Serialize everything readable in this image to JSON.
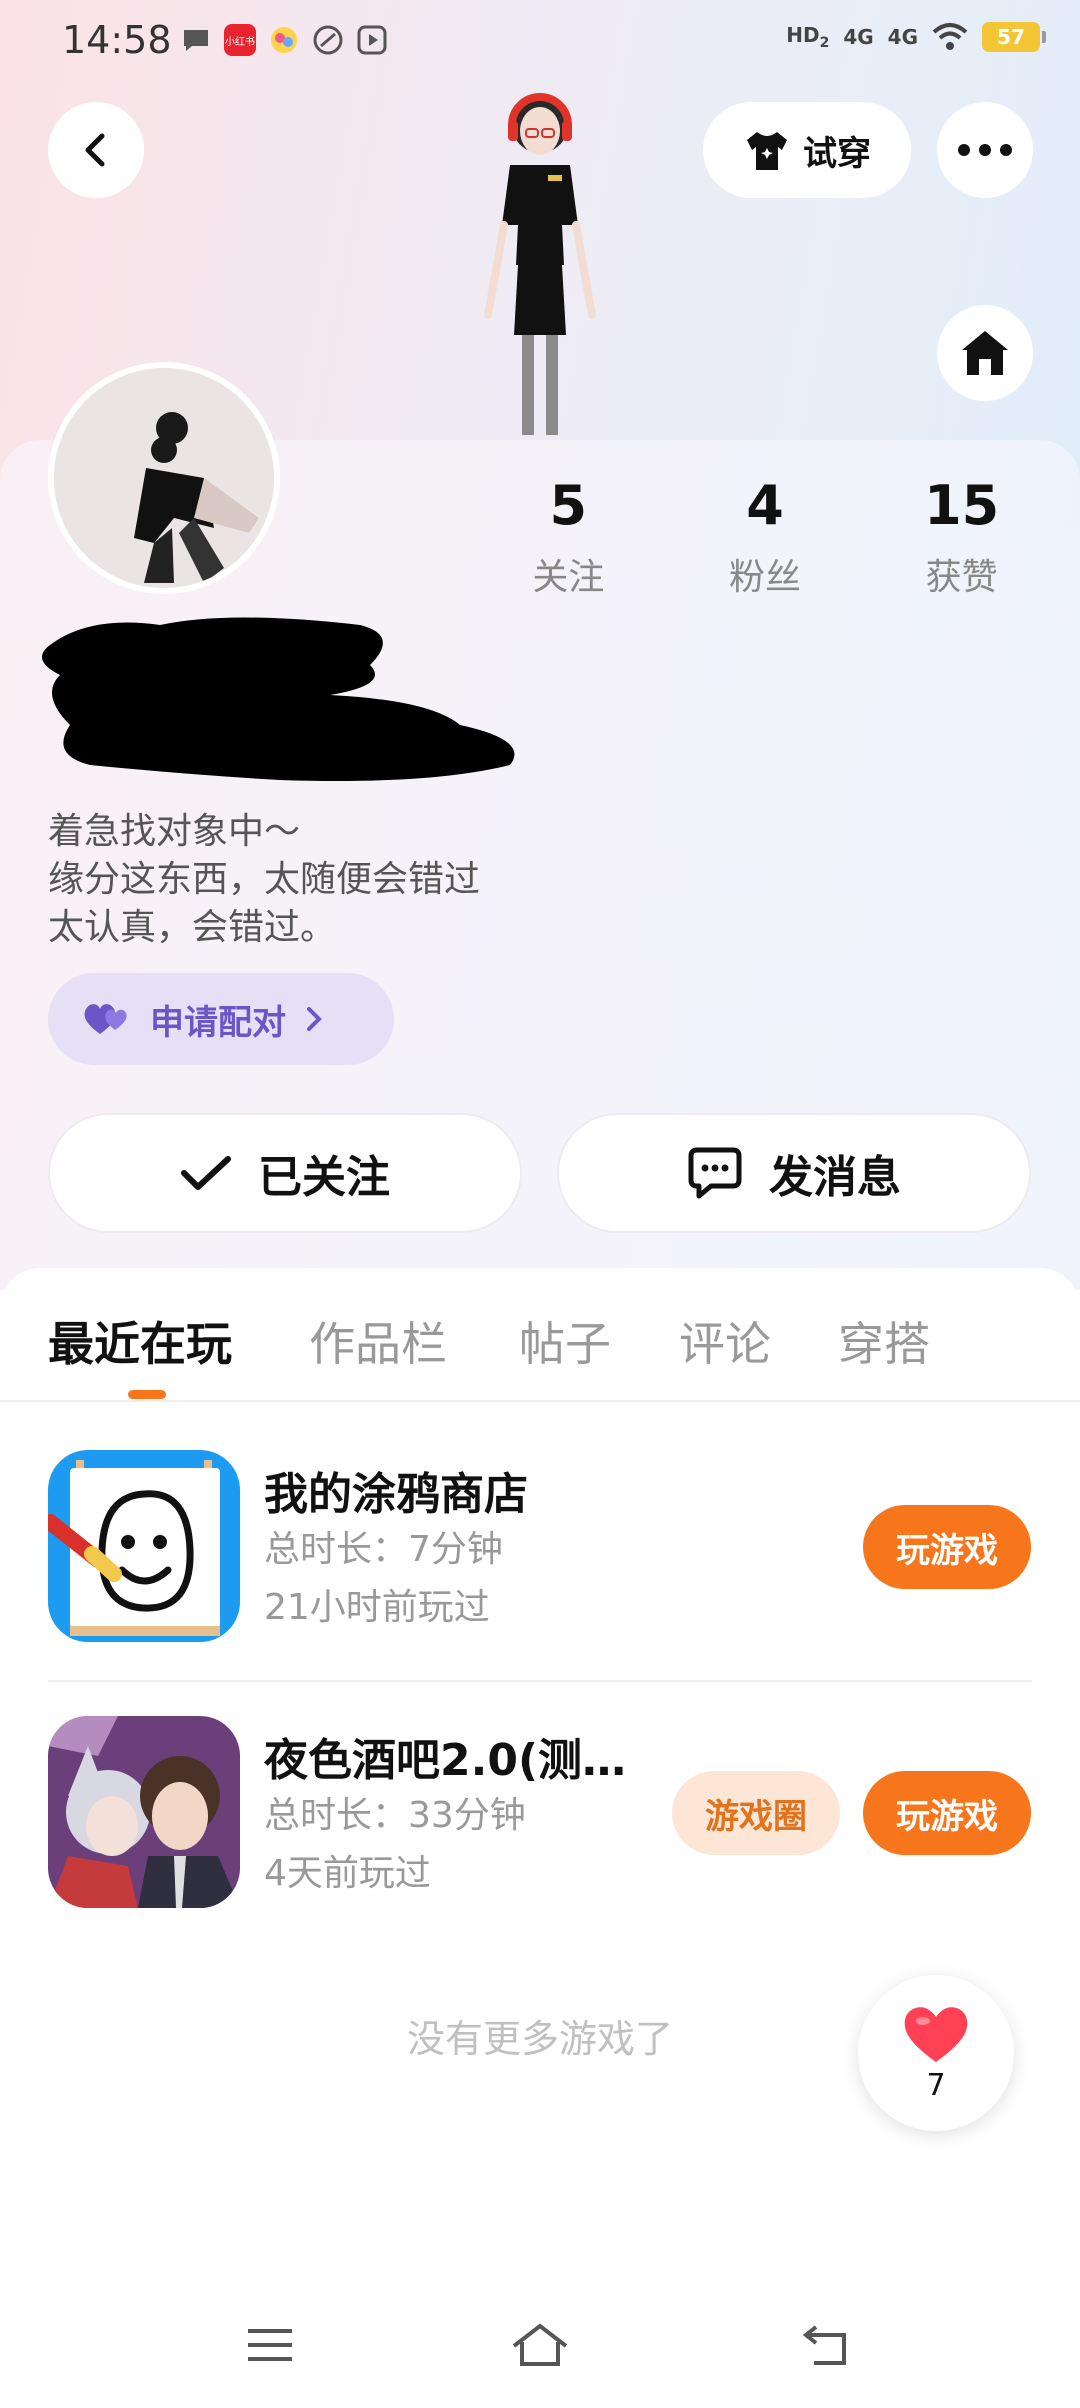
{
  "status_bar": {
    "time": "14:58",
    "notif_red_label": "小红书",
    "signal_hd": "HD",
    "signal_hd_sub": "2",
    "signal_1": "4G",
    "signal_2": "4G",
    "battery": "57"
  },
  "header": {
    "try_on_label": "试穿",
    "icons": [
      "back-arrow-icon",
      "tshirt-icon",
      "more-icon",
      "home-icon"
    ]
  },
  "profile": {
    "stats": [
      {
        "value": "5",
        "label": "关注"
      },
      {
        "value": "4",
        "label": "粉丝"
      },
      {
        "value": "15",
        "label": "获赞"
      }
    ],
    "bio_lines": [
      "着急找对象中～",
      "缘分这东西，太随便会错过",
      "太认真，会错过。"
    ],
    "pair_label": "申请配对",
    "follow_label": "已关注",
    "message_label": "发消息"
  },
  "tabs": [
    {
      "label": "最近在玩",
      "active": true
    },
    {
      "label": "作品栏",
      "active": false
    },
    {
      "label": "帖子",
      "active": false
    },
    {
      "label": "评论",
      "active": false
    },
    {
      "label": "穿搭",
      "active": false
    }
  ],
  "games": [
    {
      "title": "我的涂鸦商店",
      "duration": "总时长：7分钟",
      "last_played": "21小时前玩过",
      "play_label": "玩游戏"
    },
    {
      "title": "夜色酒吧2.0(测…",
      "duration": "总时长：33分钟",
      "last_played": "4天前玩过",
      "circle_label": "游戏圈",
      "play_label": "玩游戏"
    }
  ],
  "list_footer": "没有更多游戏了",
  "like_fab": {
    "count": "7"
  },
  "colors": {
    "accent": "#f7761b",
    "pair_bg": "#e6e0f7",
    "pair_text": "#6b56c7",
    "circle_bg": "#fde6d6",
    "circle_text": "#e0731e"
  }
}
